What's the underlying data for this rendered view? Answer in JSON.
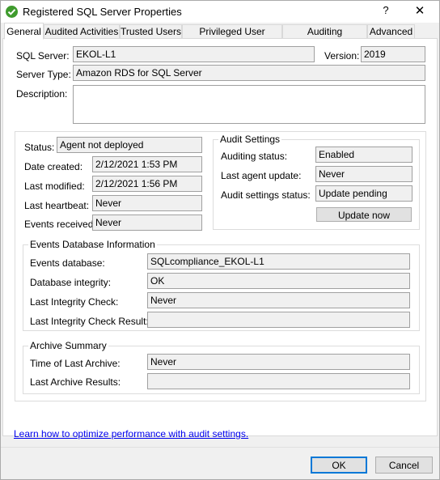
{
  "window": {
    "title": "Registered SQL Server Properties",
    "help_label": "?",
    "close_label": "✕"
  },
  "tabs": [
    {
      "label": "General",
      "active": true
    },
    {
      "label": "Audited Activities"
    },
    {
      "label": "Trusted Users"
    },
    {
      "label": "Privileged User Auditing"
    },
    {
      "label": "Auditing Thresholds"
    },
    {
      "label": "Advanced"
    }
  ],
  "server": {
    "sql_server_label": "SQL Server:",
    "sql_server_value": "EKOL-L1",
    "version_label": "Version:",
    "version_value": "2019",
    "server_type_label": "Server Type:",
    "server_type_value": "Amazon RDS for SQL Server",
    "description_label": "Description:",
    "description_value": ""
  },
  "status": {
    "status_label": "Status:",
    "status_value": "Agent not deployed",
    "date_created_label": "Date created:",
    "date_created_value": "2/12/2021 1:53 PM",
    "last_modified_label": "Last modified:",
    "last_modified_value": "2/12/2021 1:56 PM",
    "last_heartbeat_label": "Last heartbeat:",
    "last_heartbeat_value": "Never",
    "events_received_label": "Events received:",
    "events_received_value": "Never"
  },
  "audit_settings": {
    "title": "Audit Settings",
    "auditing_status_label": "Auditing status:",
    "auditing_status_value": "Enabled",
    "last_agent_update_label": "Last agent update:",
    "last_agent_update_value": "Never",
    "audit_settings_status_label": "Audit settings status:",
    "audit_settings_status_value": "Update pending",
    "update_now_label": "Update now"
  },
  "events_db": {
    "title": "Events Database Information",
    "events_database_label": "Events database:",
    "events_database_value": "SQLcompliance_EKOL-L1",
    "integrity_label": "Database integrity:",
    "integrity_value": "OK",
    "last_check_label": "Last Integrity Check:",
    "last_check_value": "Never",
    "last_check_result_label": "Last Integrity Check Result:",
    "last_check_result_value": ""
  },
  "archive": {
    "title": "Archive Summary",
    "time_label": "Time of Last Archive:",
    "time_value": "Never",
    "results_label": "Last Archive Results:",
    "results_value": ""
  },
  "footer": {
    "link_text": "Learn how to optimize performance with audit settings.",
    "ok_label": "OK",
    "cancel_label": "Cancel"
  }
}
